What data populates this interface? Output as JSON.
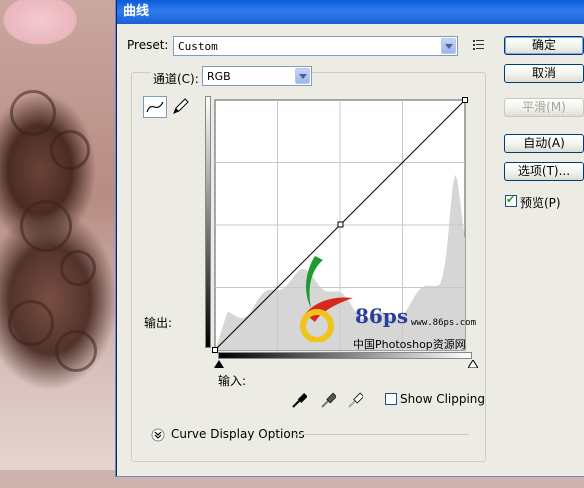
{
  "window": {
    "title": "曲线"
  },
  "preset": {
    "label": "Preset:",
    "value": "Custom"
  },
  "channel": {
    "label": "通道(C):",
    "value": "RGB"
  },
  "graph": {
    "output_label": "输出:",
    "input_label": "输入:"
  },
  "buttons": {
    "ok": "确定",
    "cancel": "取消",
    "smooth": "平滑(M)",
    "auto": "自动(A)",
    "options": "选项(T)..."
  },
  "preview": {
    "label": "预览(P)",
    "checked": true
  },
  "show_clipping": {
    "label": "Show Clipping",
    "checked": false
  },
  "curve_display_options": {
    "label": "Curve Display Options"
  },
  "watermark": {
    "text1": "86ps",
    "text2": "www.86ps.com",
    "text3": "中国Photoshop资源网"
  },
  "colors": {
    "titlebar": "#1a5fd1",
    "dialog_bg": "#ecebe4",
    "histogram": "#d6d6d6"
  },
  "curve": {
    "points": [
      [
        0,
        0
      ],
      [
        128,
        128
      ],
      [
        255,
        255
      ]
    ]
  }
}
